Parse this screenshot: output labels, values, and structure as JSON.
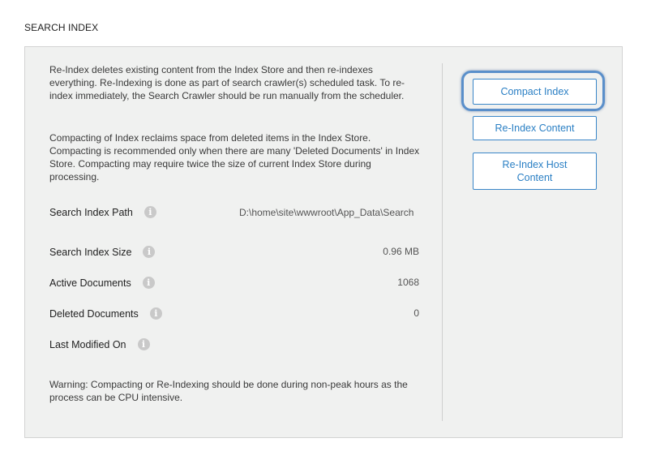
{
  "section": {
    "title": "SEARCH INDEX"
  },
  "description": {
    "reindex": "Re-Index deletes existing content from the Index Store and then re-indexes everything. Re-Indexing is done as part of search crawler(s) scheduled task. To re-index immediately, the Search Crawler should be run manually from the scheduler.",
    "compact": "Compacting of Index reclaims space from deleted items in the Index Store. Compacting is recommended only when there are many 'Deleted Documents' in Index Store. Compacting may require twice the size of current Index Store during processing."
  },
  "fields": [
    {
      "label": "Search Index Path",
      "value": "D:\\home\\site\\wwwroot\\App_Data\\Search",
      "icon": "info-icon"
    },
    {
      "label": "Search Index Size",
      "value": "0.96 MB",
      "icon": "info-icon"
    },
    {
      "label": "Active Documents",
      "value": "1068",
      "icon": "info-icon"
    },
    {
      "label": "Deleted Documents",
      "value": "0",
      "icon": "info-icon"
    },
    {
      "label": "Last Modified On",
      "value": "",
      "icon": "info-icon"
    }
  ],
  "warning": "Warning: Compacting or Re-Indexing should be done during non-peak hours as the process can be CPU intensive.",
  "actions": {
    "compact_label": "Compact Index",
    "reindex_content_label": "Re-Index Content",
    "reindex_host_label": "Re-Index Host Content"
  },
  "colors": {
    "accent": "#2a7fc4",
    "panel_bg": "#f0f1f0",
    "focus_ring": "#5a8fca"
  },
  "focused_button": "compact_label"
}
